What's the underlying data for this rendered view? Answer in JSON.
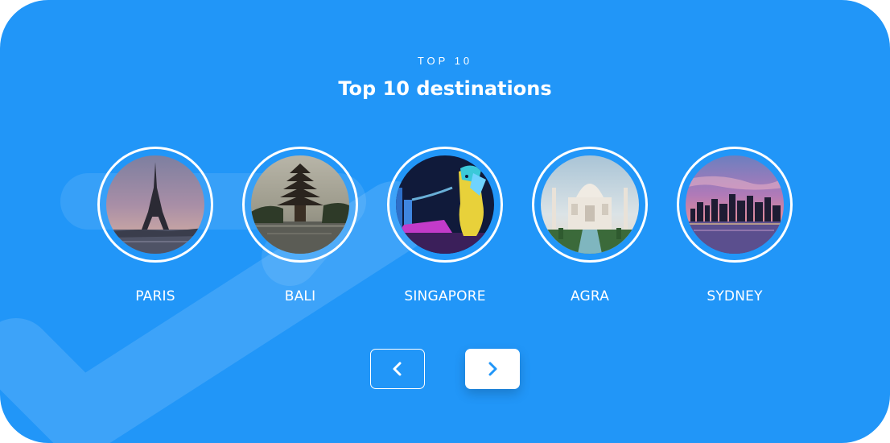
{
  "header": {
    "eyebrow": "TOP 10",
    "title": "Top 10 destinations"
  },
  "destinations": [
    {
      "label": "PARIS",
      "image": "eiffel-tower-photo"
    },
    {
      "label": "BALI",
      "image": "bali-temple-photo"
    },
    {
      "label": "SINGAPORE",
      "image": "merlion-photo"
    },
    {
      "label": "AGRA",
      "image": "taj-mahal-photo"
    },
    {
      "label": "SYDNEY",
      "image": "sydney-skyline-photo"
    }
  ],
  "navigation": {
    "prev_icon": "chevron-left-icon",
    "next_icon": "chevron-right-icon"
  },
  "colors": {
    "background": "#2196f8",
    "text": "#ffffff",
    "button_active_bg": "#ffffff",
    "chevron_active": "#2196f8"
  }
}
